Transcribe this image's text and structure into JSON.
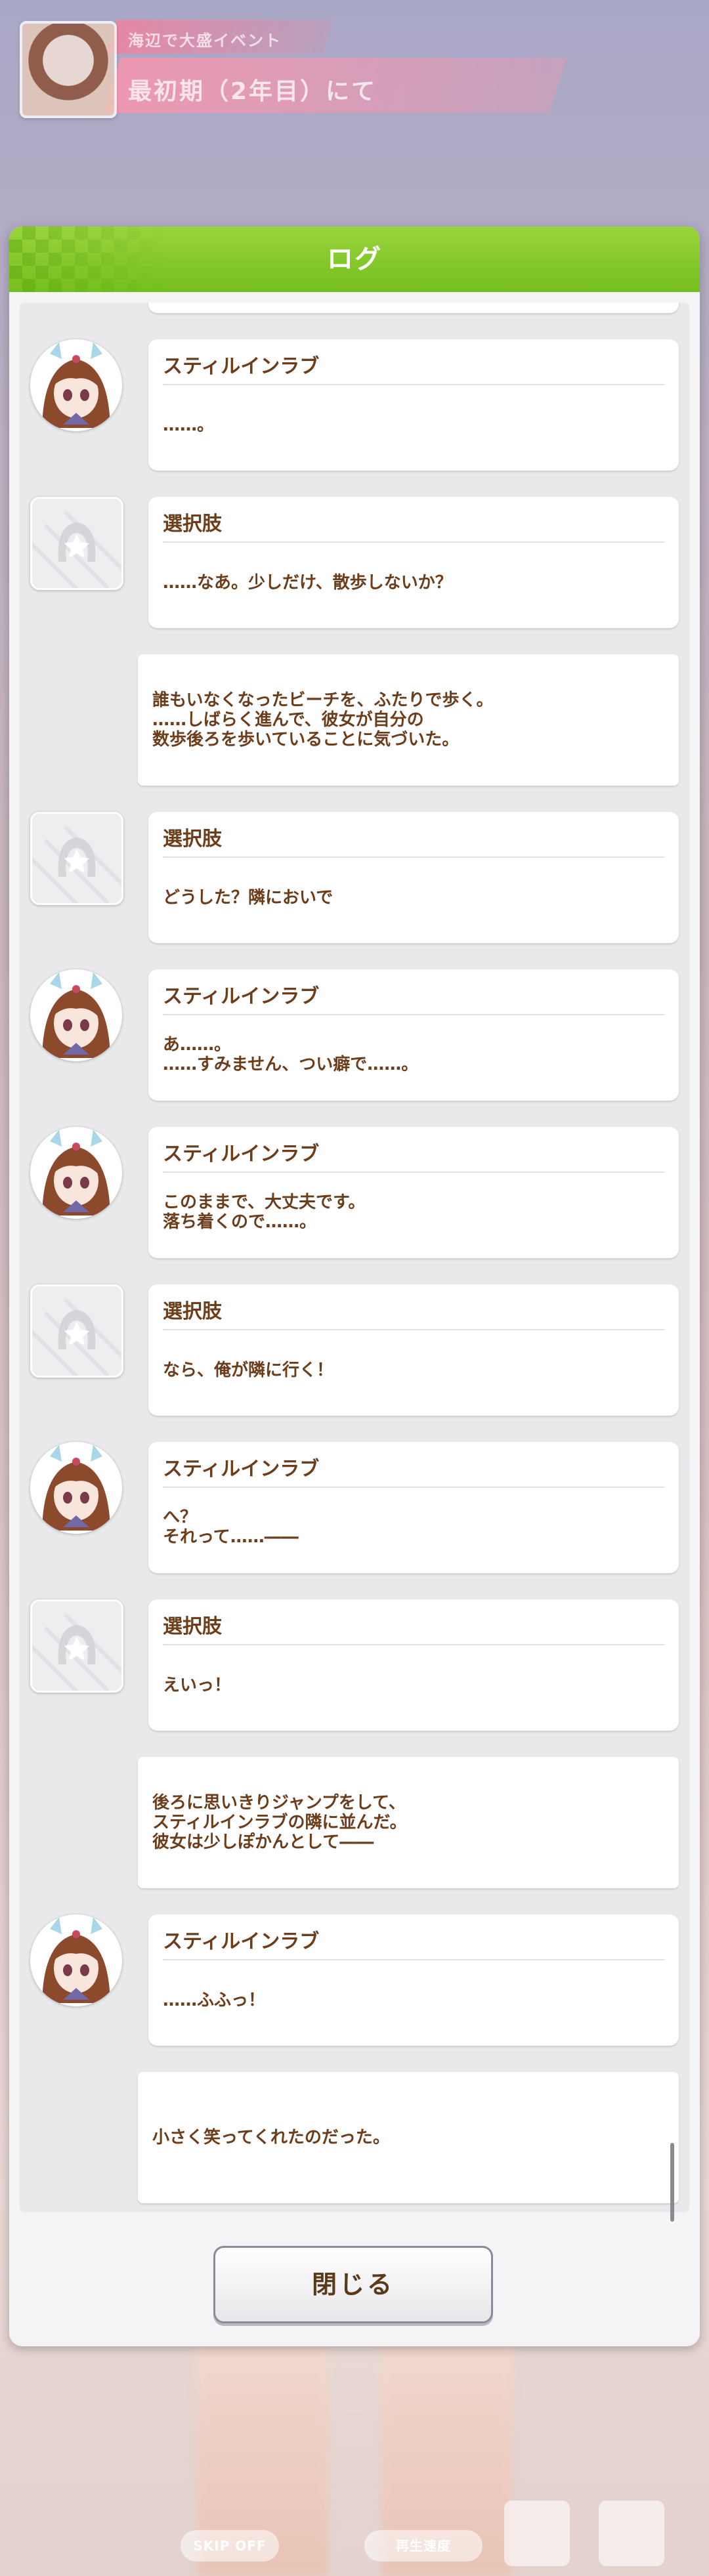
{
  "banner": {
    "line1": "海辺で大盛イベント",
    "line2": "最初期（2年目）にて"
  },
  "log": {
    "title": "ログ",
    "close_label": "閉じる",
    "entries": [
      {
        "type": "chara",
        "speaker": "スティルインラブ",
        "text": "……。"
      },
      {
        "type": "choice",
        "speaker": "選択肢",
        "text": "……なあ。少しだけ、散歩しないか？"
      },
      {
        "type": "narration",
        "text": "誰もいなくなったビーチを、ふたりで歩く。\n……しばらく進んで、彼女が自分の\n数歩後ろを歩いていることに気づいた。"
      },
      {
        "type": "choice",
        "speaker": "選択肢",
        "text": "どうした？隣においで"
      },
      {
        "type": "chara",
        "speaker": "スティルインラブ",
        "text": "あ……。\n……すみません、つい癖で……。"
      },
      {
        "type": "chara",
        "speaker": "スティルインラブ",
        "text": "このままで、大丈夫です。\n落ち着くので……。"
      },
      {
        "type": "choice",
        "speaker": "選択肢",
        "text": "なら、俺が隣に行く！"
      },
      {
        "type": "chara",
        "speaker": "スティルインラブ",
        "text": "へ？\nそれって……――"
      },
      {
        "type": "choice",
        "speaker": "選択肢",
        "text": "えいっ！"
      },
      {
        "type": "narration",
        "text": "後ろに思いきりジャンプをして、\nスティルインラブの隣に並んだ。\n彼女は少しぽかんとして――"
      },
      {
        "type": "chara",
        "speaker": "スティルインラブ",
        "text": "……ふふっ！"
      },
      {
        "type": "narration",
        "text": "小さく笑ってくれたのだった。"
      }
    ]
  },
  "footer": {
    "skip_label": "SKIP OFF",
    "auto_label": "再生速度"
  },
  "colors": {
    "header_green": "#84c92a",
    "text_brown": "#6b3d1b"
  }
}
